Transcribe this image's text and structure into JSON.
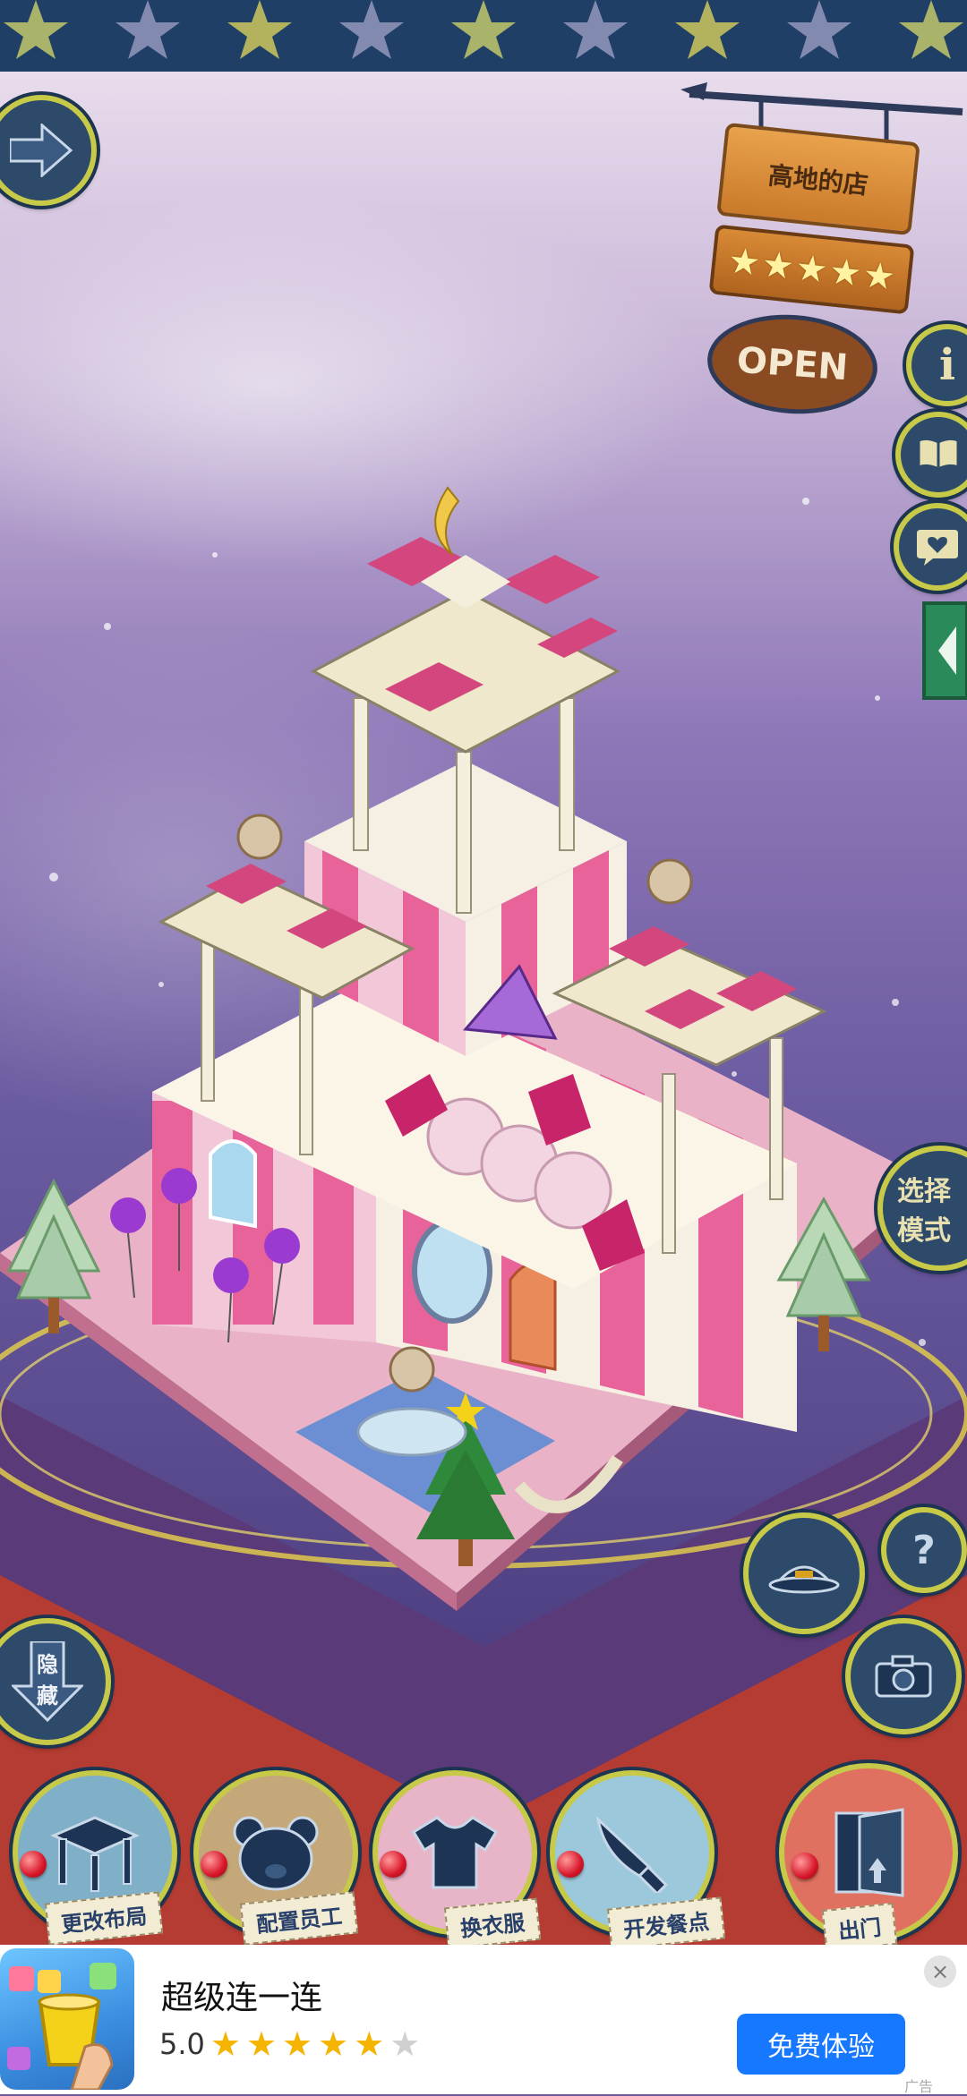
{
  "shop": {
    "name": "高地的店",
    "rating_stars": 5,
    "status": "OPEN"
  },
  "side_buttons": {
    "info": "i",
    "select_mode_line1": "选择",
    "select_mode_line2": "模式",
    "hide_line1": "隐",
    "hide_line2": "藏",
    "help": "?"
  },
  "bottom_menu": [
    {
      "label": "更改布局",
      "icon": "table-icon"
    },
    {
      "label": "配置员工",
      "icon": "bear-head-icon"
    },
    {
      "label": "换衣服",
      "icon": "shirt-icon"
    },
    {
      "label": "开发餐点",
      "icon": "knife-icon"
    },
    {
      "label": "出门",
      "icon": "door-icon"
    }
  ],
  "ad": {
    "title": "超级连一连",
    "rating": "5.0",
    "stars_filled": 5,
    "stars_total": 6,
    "cta": "免费体验",
    "close": "×",
    "tag": "广告"
  },
  "colors": {
    "frame_blue": "#2d4a6a",
    "frame_yellow": "#c7c948",
    "ad_button": "#1677ff",
    "pink": "#e8639a",
    "star_yellow": "#f4b400"
  }
}
